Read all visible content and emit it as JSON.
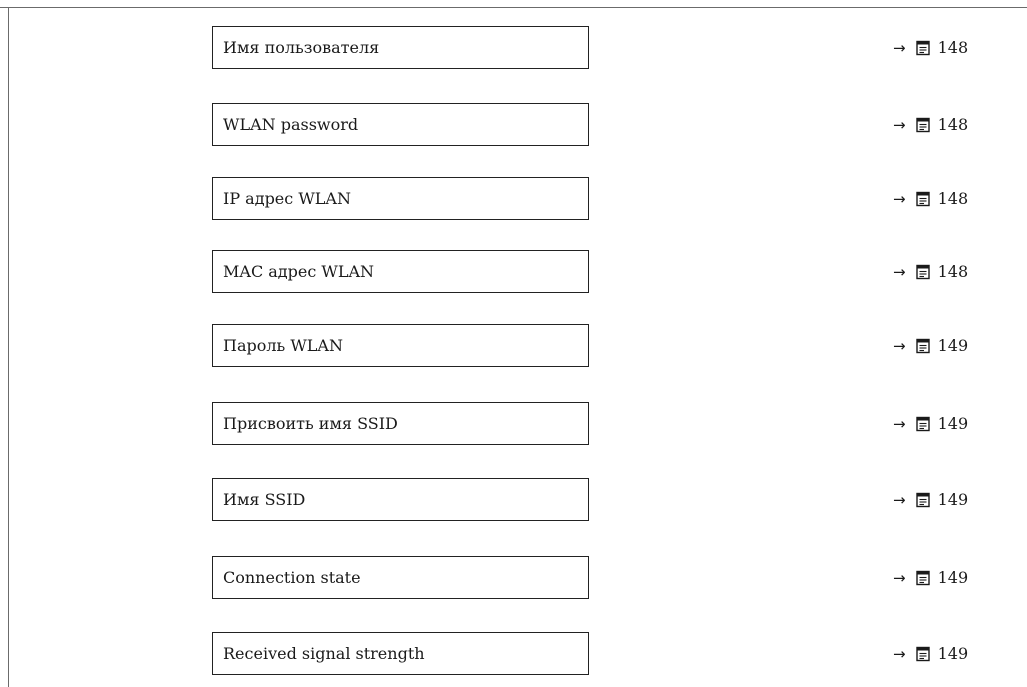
{
  "parameters": [
    {
      "label": "Имя пользователя",
      "ref_arrow": "→",
      "ref_icon": "page-reference-icon",
      "page": "148"
    },
    {
      "label": "WLAN password",
      "ref_arrow": "→",
      "ref_icon": "page-reference-icon",
      "page": "148"
    },
    {
      "label": "IP адрес WLAN",
      "ref_arrow": "→",
      "ref_icon": "page-reference-icon",
      "page": "148"
    },
    {
      "label": "MAC адрес WLAN",
      "ref_arrow": "→",
      "ref_icon": "page-reference-icon",
      "page": "148"
    },
    {
      "label": "Пароль WLAN",
      "ref_arrow": "→",
      "ref_icon": "page-reference-icon",
      "page": "149"
    },
    {
      "label": "Присвоить имя SSID",
      "ref_arrow": "→",
      "ref_icon": "page-reference-icon",
      "page": "149"
    },
    {
      "label": "Имя SSID",
      "ref_arrow": "→",
      "ref_icon": "page-reference-icon",
      "page": "149"
    },
    {
      "label": "Connection state",
      "ref_arrow": "→",
      "ref_icon": "page-reference-icon",
      "page": "149"
    },
    {
      "label": "Received signal strength",
      "ref_arrow": "→",
      "ref_icon": "page-reference-icon",
      "page": "149"
    }
  ]
}
